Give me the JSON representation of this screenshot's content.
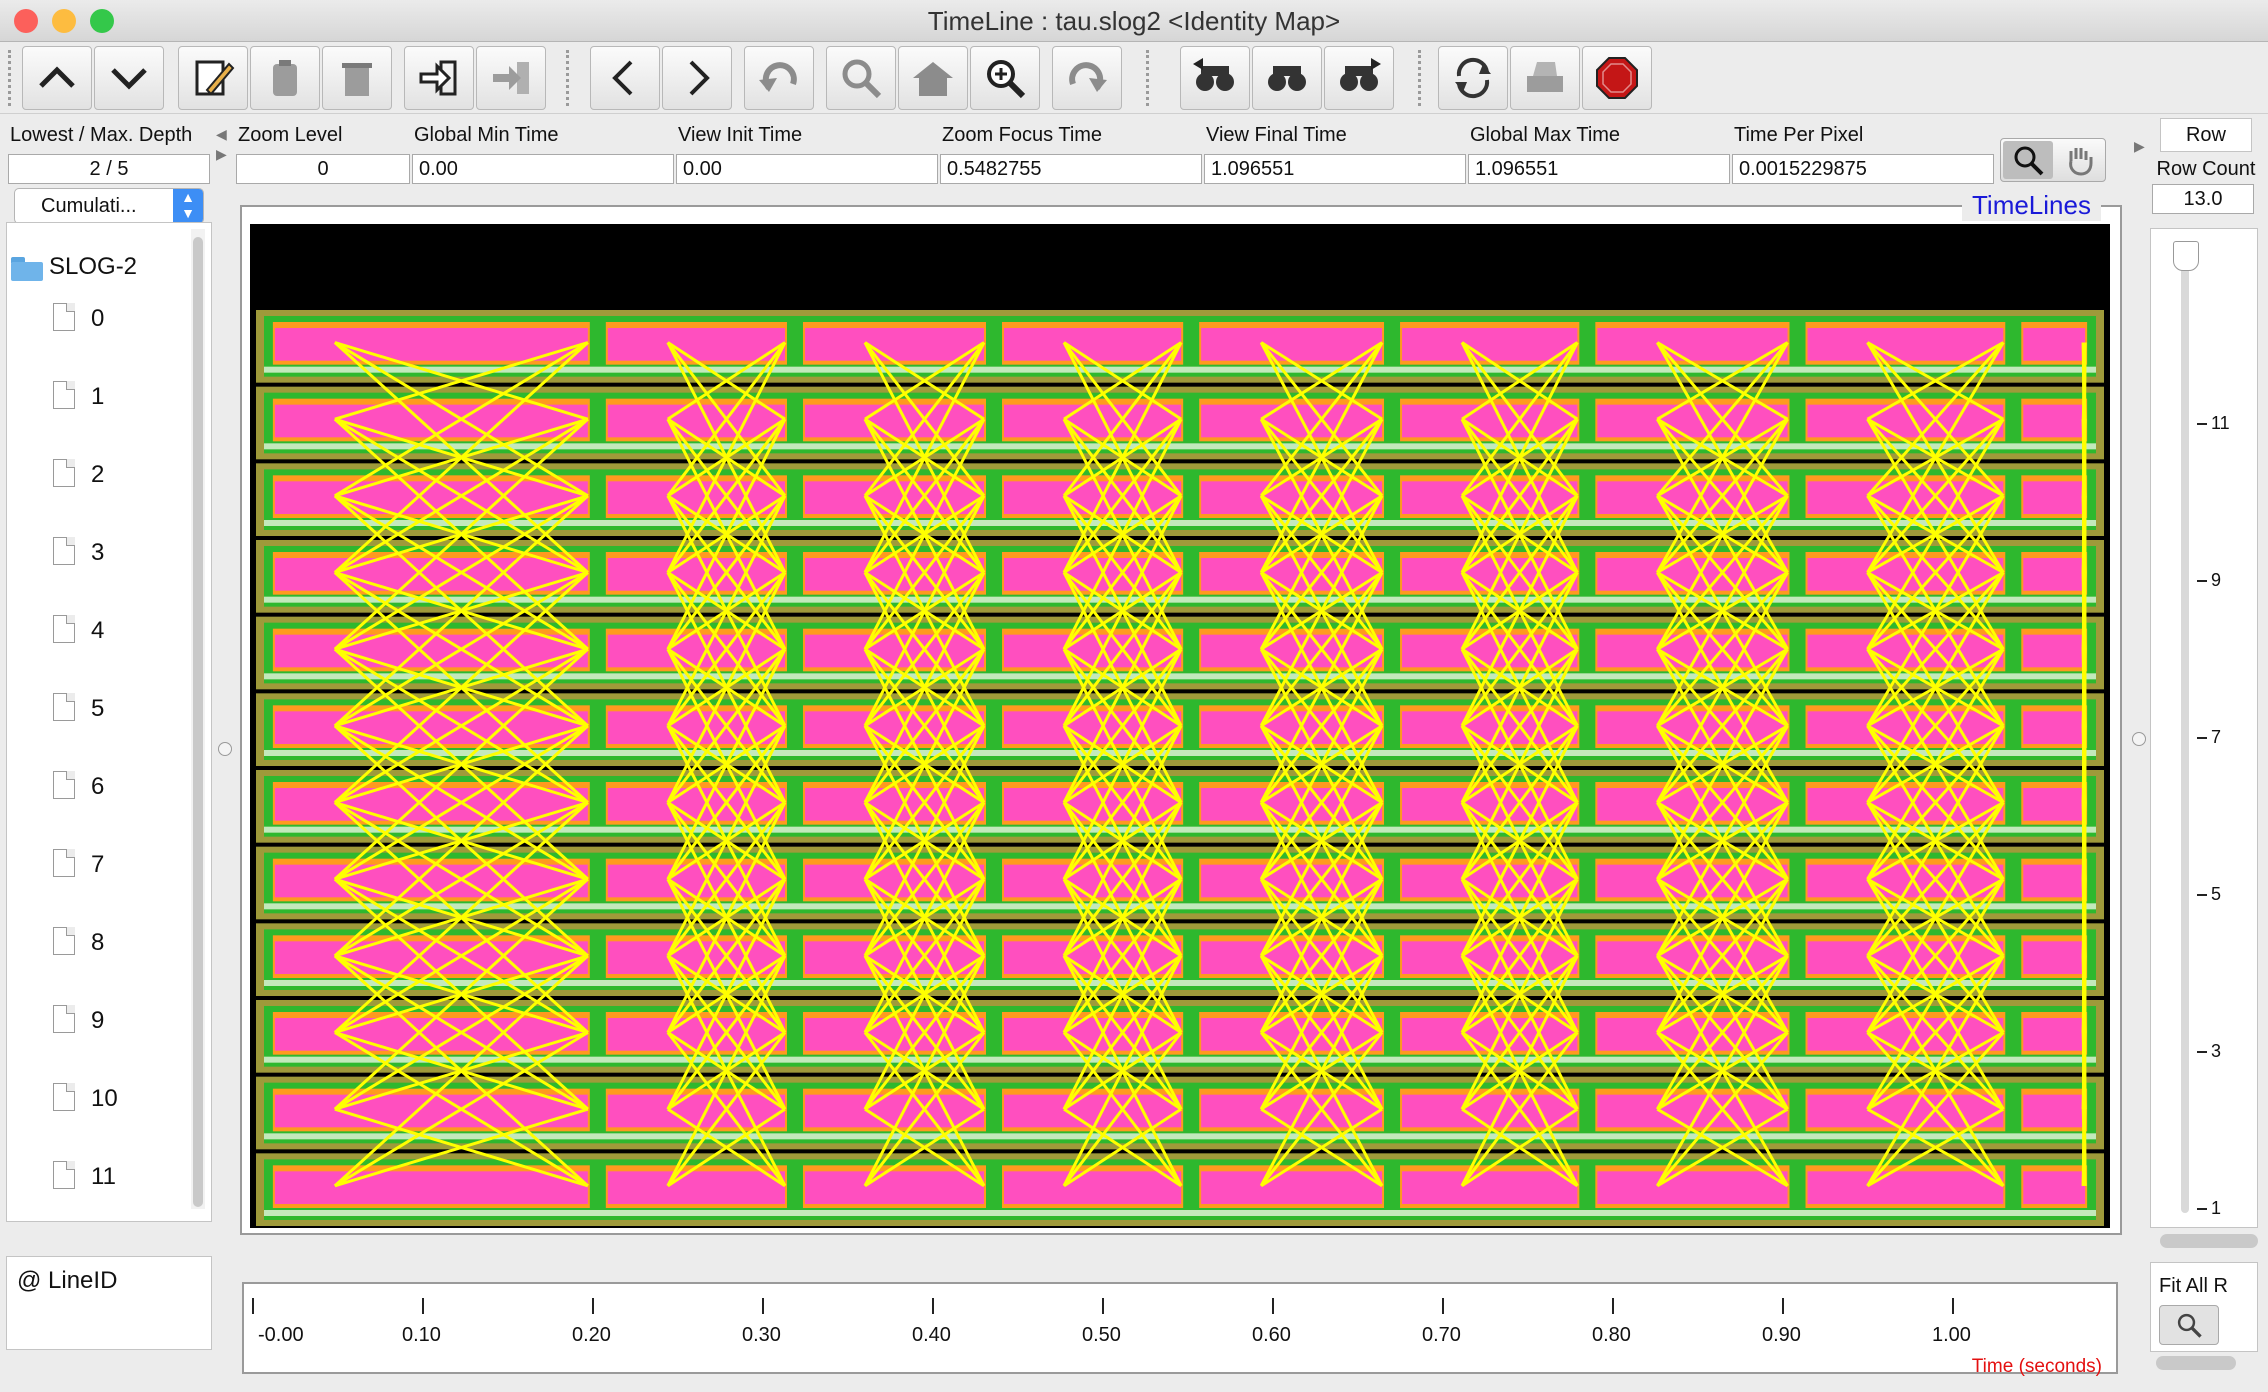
{
  "window": {
    "title": "TimeLine : tau.slog2  <Identity Map>",
    "traffic_colors": [
      "#fc605b",
      "#fdbc40",
      "#34c84a"
    ]
  },
  "toolbar": {
    "buttons": [
      {
        "name": "up-icon"
      },
      {
        "name": "down-icon"
      },
      {
        "name": "edit-icon"
      },
      {
        "name": "paste-icon"
      },
      {
        "name": "trash-icon"
      },
      {
        "name": "enter-icon"
      },
      {
        "name": "exit-icon"
      },
      {
        "name": "back-icon"
      },
      {
        "name": "forward-icon"
      },
      {
        "name": "undo-icon"
      },
      {
        "name": "zoom-out-icon"
      },
      {
        "name": "home-icon"
      },
      {
        "name": "zoom-in-icon"
      },
      {
        "name": "redo-icon"
      },
      {
        "name": "search-back-icon"
      },
      {
        "name": "search-icon"
      },
      {
        "name": "search-forward-icon"
      },
      {
        "name": "refresh-icon"
      },
      {
        "name": "print-icon"
      },
      {
        "name": "stop-icon"
      }
    ]
  },
  "fields": {
    "depth": {
      "label": "Lowest / Max. Depth",
      "value": "2 / 5"
    },
    "zoom_level": {
      "label": "Zoom Level",
      "value": "0"
    },
    "global_min": {
      "label": "Global Min Time",
      "value": "0.00"
    },
    "view_init": {
      "label": "View  Init Time",
      "value": "0.00"
    },
    "zoom_focus": {
      "label": "Zoom Focus Time",
      "value": "0.5482755"
    },
    "view_final": {
      "label": "View Final Time",
      "value": "1.096551"
    },
    "global_max": {
      "label": "Global Max Time",
      "value": "1.096551"
    },
    "time_per_pixel": {
      "label": "Time Per Pixel",
      "value": "0.0015229875"
    }
  },
  "left": {
    "dropdown": "Cumulati...",
    "root": "SLOG-2",
    "items": [
      "0",
      "1",
      "2",
      "3",
      "4",
      "5",
      "6",
      "7",
      "8",
      "9",
      "10",
      "11"
    ],
    "lineid": "@ LineID"
  },
  "canvas": {
    "title": "TimeLines",
    "rows": 12,
    "column_breaks": [
      0.187,
      0.293,
      0.4,
      0.506,
      0.614,
      0.719,
      0.832,
      0.948
    ],
    "colors": {
      "state_pink": "#ff4fbf",
      "state_green": "#2eb82e",
      "state_olive": "#9f9a3a",
      "orange": "#ff9a1f",
      "arrow": "#ffff00",
      "light": "#e8f5e0"
    }
  },
  "axis": {
    "ticks": [
      "-0.00",
      "0.10",
      "0.20",
      "0.30",
      "0.40",
      "0.50",
      "0.60",
      "0.70",
      "0.80",
      "0.90",
      "1.00"
    ],
    "label": "Time (seconds)"
  },
  "right": {
    "row_label": "Row",
    "row_count_label": "Row Count",
    "row_count": "13.0",
    "ruler": [
      "11",
      "9",
      "7",
      "5",
      "3",
      "1"
    ],
    "fit_label": "Fit All R"
  }
}
